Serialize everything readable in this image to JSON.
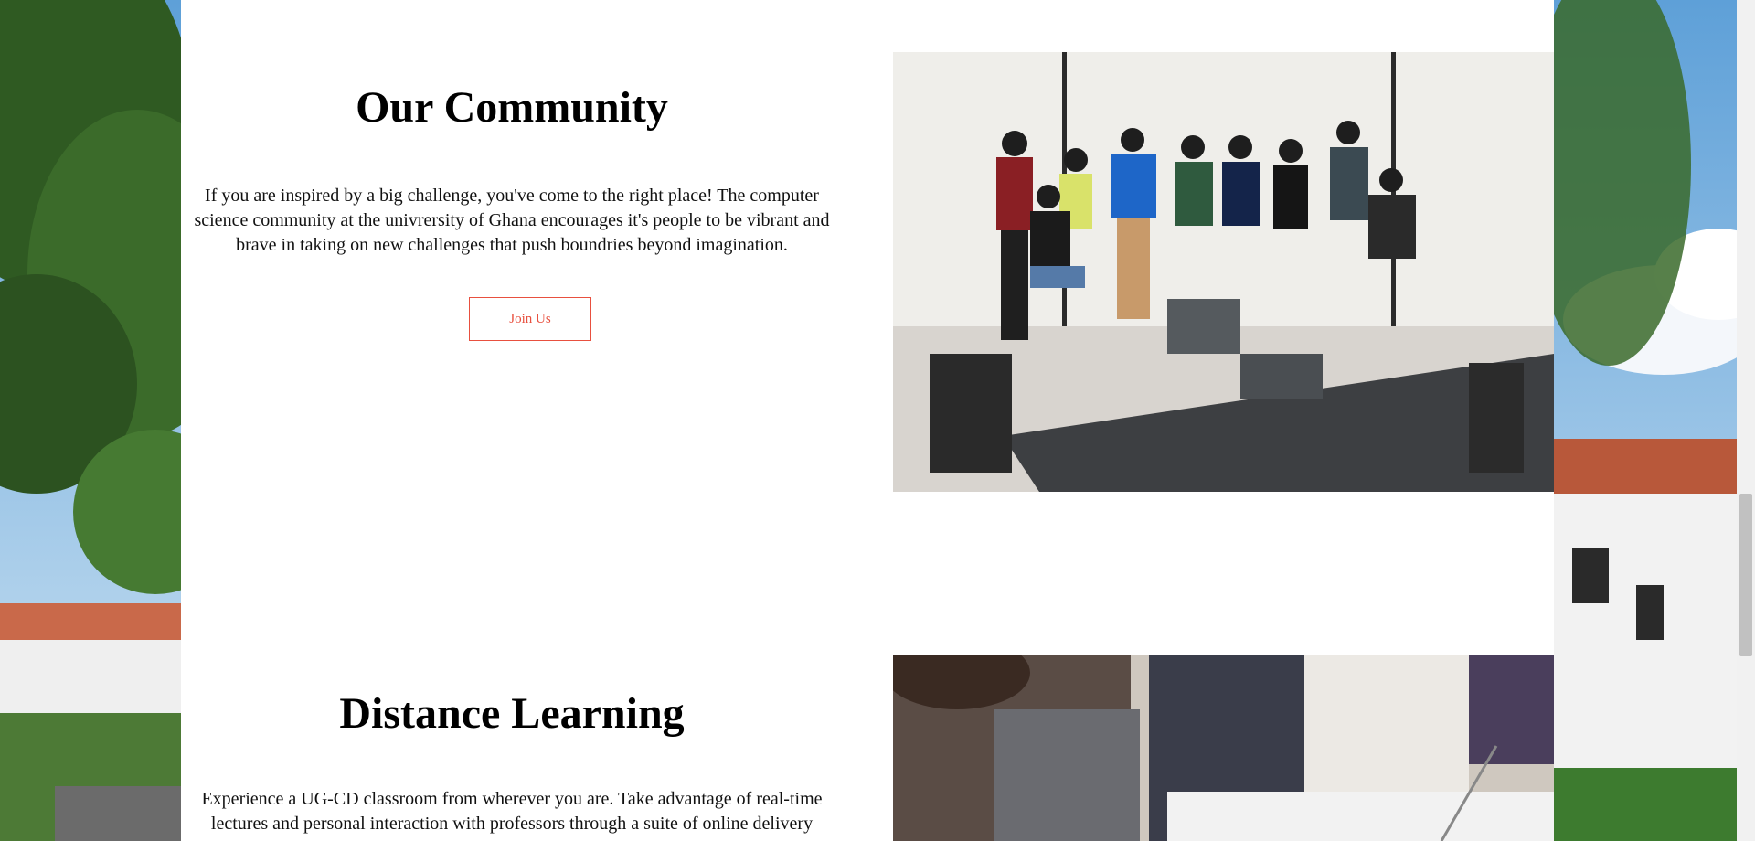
{
  "community": {
    "title": "Our Community",
    "body": "If you are inspired by a big challenge, you've come to the right place! The computer science community at the univrersity of Ghana encourages it's people to be vibrant and brave in taking on new challenges that push boundries beyond imagination.",
    "button_label": "Join Us"
  },
  "distance": {
    "title": "Distance Learning",
    "body": "Experience a UG-CD classroom from wherever you are. Take advantage of real-time lectures and personal interaction with professors through a suite of online delivery"
  },
  "colors": {
    "accent": "#e8503f",
    "page_bg": "#ffffff"
  }
}
